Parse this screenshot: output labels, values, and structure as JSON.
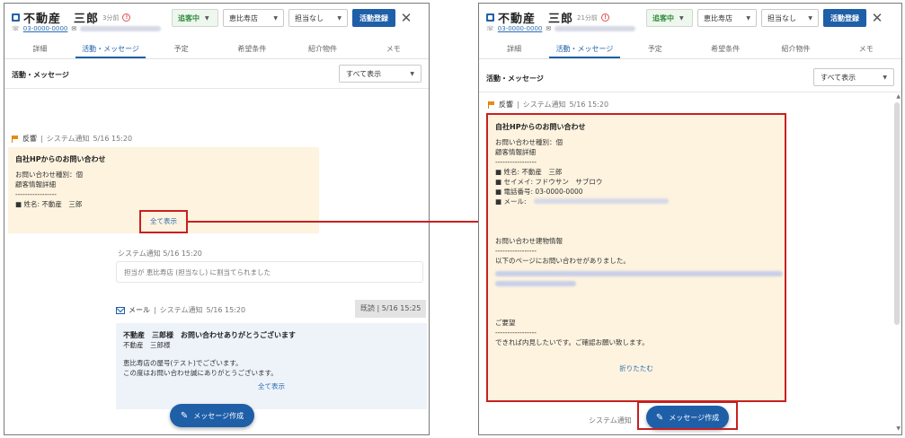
{
  "customer": {
    "name": "不動産　三郎",
    "ago_left": "3分前",
    "ago_right": "21分前",
    "phone": "03-0000-0000"
  },
  "controls": {
    "status": "追客中",
    "store": "恵比寿店",
    "assignee": "担当なし",
    "register": "活動登録",
    "close": "✕"
  },
  "tabs": [
    "詳細",
    "活動・メッセージ",
    "予定",
    "希望条件",
    "紹介物件",
    "メモ"
  ],
  "section": {
    "title": "活動・メッセージ",
    "filter": "すべて表示"
  },
  "inquiry_event": {
    "type": "反響",
    "source": "システム通知",
    "time": "5/16 15:20",
    "title": "自社HPからのお問い合わせ",
    "lines_short": [
      "お問い合わせ種別：個",
      "顧客情報詳細",
      "-----------------",
      "■ 姓名: 不動産　三郎"
    ],
    "lines_full": [
      "お問い合わせ種別：個",
      "顧客情報詳細",
      "-----------------",
      "■ 姓名: 不動産　三郎",
      "■ セイメイ: フドウサン　サブロウ",
      "■ 電話番号: 03-0000-0000",
      "■ メール:"
    ],
    "building_info_label": "お問い合わせ建物情報",
    "building_dashes": "-----------------",
    "building_desc": "以下のページにお問い合わせがありました。",
    "request_label": "ご要望",
    "request_dashes": "-----------------",
    "request_text": "できれば内見したいです。ご確認お願い致します。",
    "show_all": "全て表示",
    "collapse": "折りたたむ"
  },
  "system_event": {
    "source": "システム通知",
    "time": "5/16 15:20",
    "message": "担当が 恵比寿店 (担当なし) に割当てられました"
  },
  "mail_event": {
    "type": "メール",
    "source": "システム通知",
    "time": "5/16 15:20",
    "read_badge": "既読 | 5/16 15:25",
    "subject": "不動産　三郎様　お問い合わせありがとうございます",
    "line1": "不動産　三郎様",
    "line2": "恵比寿店の屋号(テスト)でございます。",
    "line3": "この度はお問い合わせ誠にありがとうございます。",
    "show_all": "全て表示"
  },
  "compose": {
    "label": "メッセージ作成"
  },
  "colors": {
    "primary": "#1e5fa8",
    "status_green": "#2e8b3a",
    "inquiry_bg": "#fdf3df",
    "mail_bg": "#eef3fa",
    "highlight_red": "#c82020",
    "flag_orange": "#e98a14"
  }
}
